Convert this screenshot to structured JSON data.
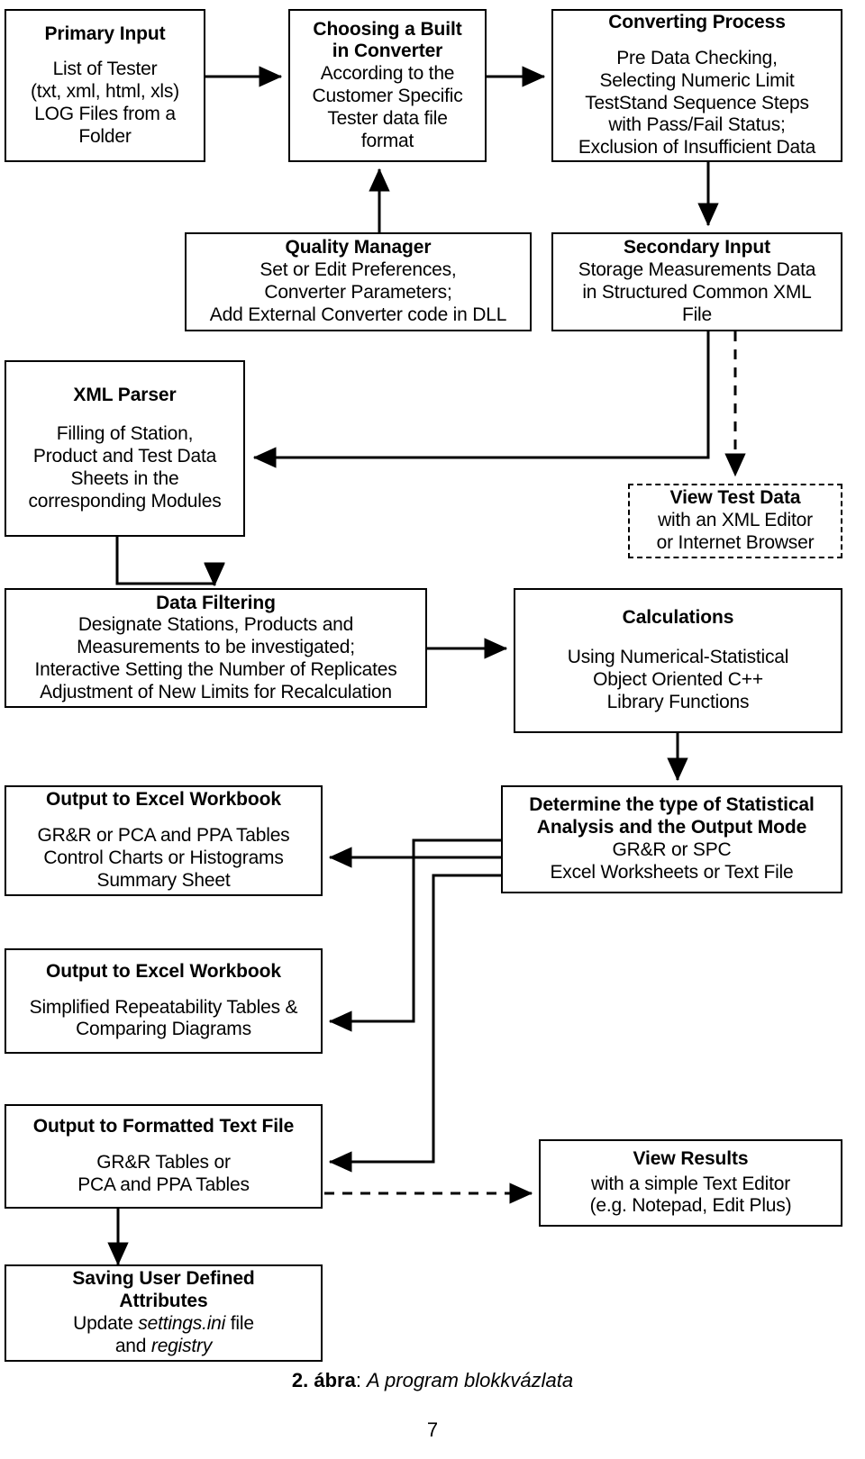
{
  "figure": {
    "caption_label": "2. ábra",
    "caption_sep": ": ",
    "caption_text": "A program blokkvázlata",
    "page_number": "7"
  },
  "nodes": {
    "primary_input": {
      "title": "Primary Input",
      "line1": "List of Tester",
      "line2": "(txt, xml, html, xls)",
      "line3": "LOG Files from a",
      "line4": "Folder"
    },
    "choosing_converter": {
      "title_line1": "Choosing a Built",
      "title_line2": "in Converter",
      "line1": "According to the",
      "line2": "Customer Specific",
      "line3": "Tester data file",
      "line4": "format"
    },
    "converting_process": {
      "title": "Converting Process",
      "line1": "Pre Data Checking,",
      "line2": "Selecting Numeric Limit",
      "line3": "TestStand Sequence Steps",
      "line4": "with Pass/Fail Status;",
      "line5": "Exclusion of Insufficient Data"
    },
    "quality_manager": {
      "title": "Quality Manager",
      "line1": "Set or Edit Preferences,",
      "line2": "Converter Parameters;",
      "line3": "Add External Converter code in DLL"
    },
    "secondary_input": {
      "title": "Secondary Input",
      "line1": "Storage Measurements Data",
      "line2": "in Structured Common XML",
      "line3": "File"
    },
    "xml_parser": {
      "title": "XML Parser",
      "line1": "Filling of Station,",
      "line2": "Product and Test Data",
      "line3": "Sheets in the",
      "line4": "corresponding Modules"
    },
    "view_test_data": {
      "title": "View Test Data",
      "line1": "with an XML Editor",
      "line2": "or Internet Browser"
    },
    "data_filtering": {
      "title": "Data Filtering",
      "line1": "Designate Stations, Products and",
      "line2": "Measurements to be investigated;",
      "line3": "Interactive Setting the Number of Replicates",
      "line4": "Adjustment of New Limits for Recalculation"
    },
    "calculations": {
      "title": "Calculations",
      "line1": "Using Numerical-Statistical",
      "line2": "Object Oriented C++",
      "line3": "Library Functions"
    },
    "output_excel_1": {
      "title": "Output to Excel Workbook",
      "line1": "GR&R or PCA and PPA Tables",
      "line2": "Control Charts or Histograms",
      "line3": "Summary Sheet"
    },
    "determine_type": {
      "title_line1": "Determine the type of Statistical",
      "title_line2": "Analysis and the Output Mode",
      "line1": "GR&R or SPC",
      "line2": "Excel Worksheets or Text File"
    },
    "output_excel_2": {
      "title": "Output to Excel Workbook",
      "line1": "Simplified Repeatability Tables &",
      "line2": "Comparing Diagrams"
    },
    "output_text_file": {
      "title": "Output to Formatted Text File",
      "line1": "GR&R Tables or",
      "line2": "PCA and PPA Tables"
    },
    "view_results": {
      "title": "View Results",
      "line1": "with a simple Text Editor",
      "line2": "(e.g. Notepad, Edit Plus)"
    },
    "saving_attributes": {
      "title_line1": "Saving User Defined",
      "title_line2": "Attributes",
      "line1_pre": "Update ",
      "line1_ital": "settings.ini",
      "line1_post": " file",
      "line2_pre": "and ",
      "line2_ital": "registry"
    }
  },
  "colors": {
    "stroke": "#000000",
    "fill": "#ffffff"
  }
}
